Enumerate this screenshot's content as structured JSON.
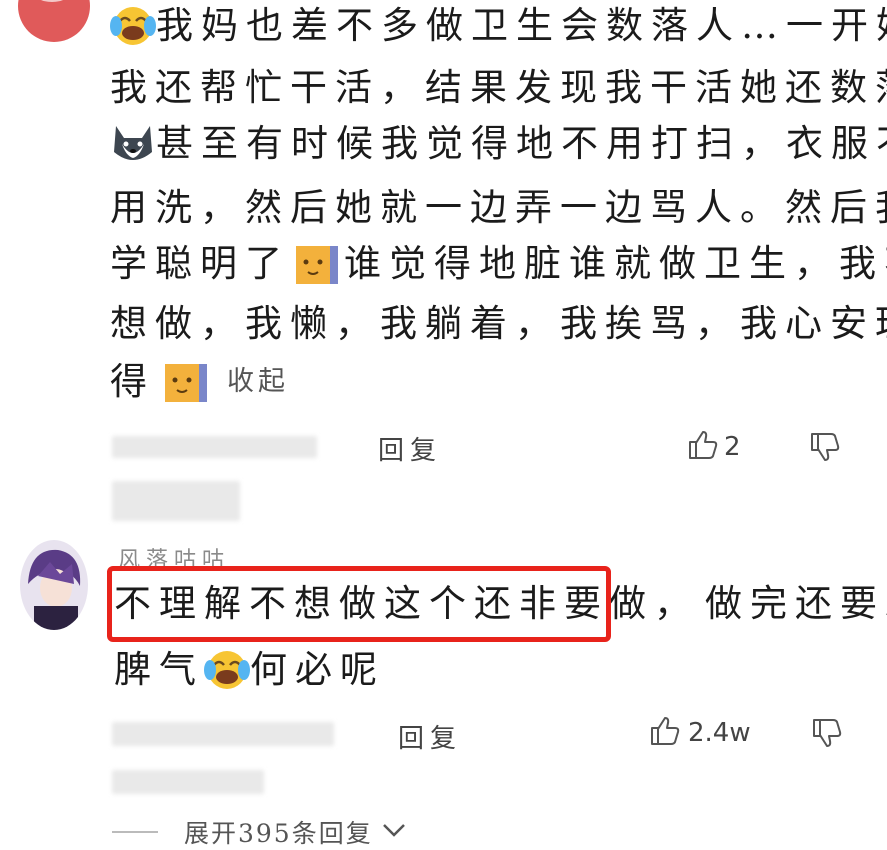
{
  "comment1": {
    "lines": [
      "我妈也差不多做卫生会数落人…一开始",
      "我还帮忙干活，结果发现我干活她还数落",
      "甚至有时候我觉得地不用打扫，衣服不",
      "用洗，然后她就一边弄一边骂人。然后我",
      "学聪明了",
      "谁觉得地脏谁就做卫生，我不",
      "想做，我懒，我躺着，我挨骂，我心安理",
      "得"
    ],
    "collapse_label": "收起",
    "reply_label": "回复",
    "like_count": "2"
  },
  "comment2": {
    "username": "风落咕咕",
    "highlight_text": "不理解不想做这个还非要做，",
    "line1_rest": "做完还要发",
    "line2_a": "脾气",
    "line2_b": "何必呢",
    "reply_label": "回复",
    "like_count": "2.4w",
    "expand_label": "展开395条回复"
  },
  "colors": {
    "highlight_border": "#e8231b",
    "text": "#1b1b1b",
    "muted": "#444444"
  },
  "icons": [
    "laughing-cry-emoji",
    "husky-dog-emoji",
    "cat-emoji",
    "thumb-up-icon",
    "thumb-down-icon",
    "chevron-down-icon"
  ]
}
